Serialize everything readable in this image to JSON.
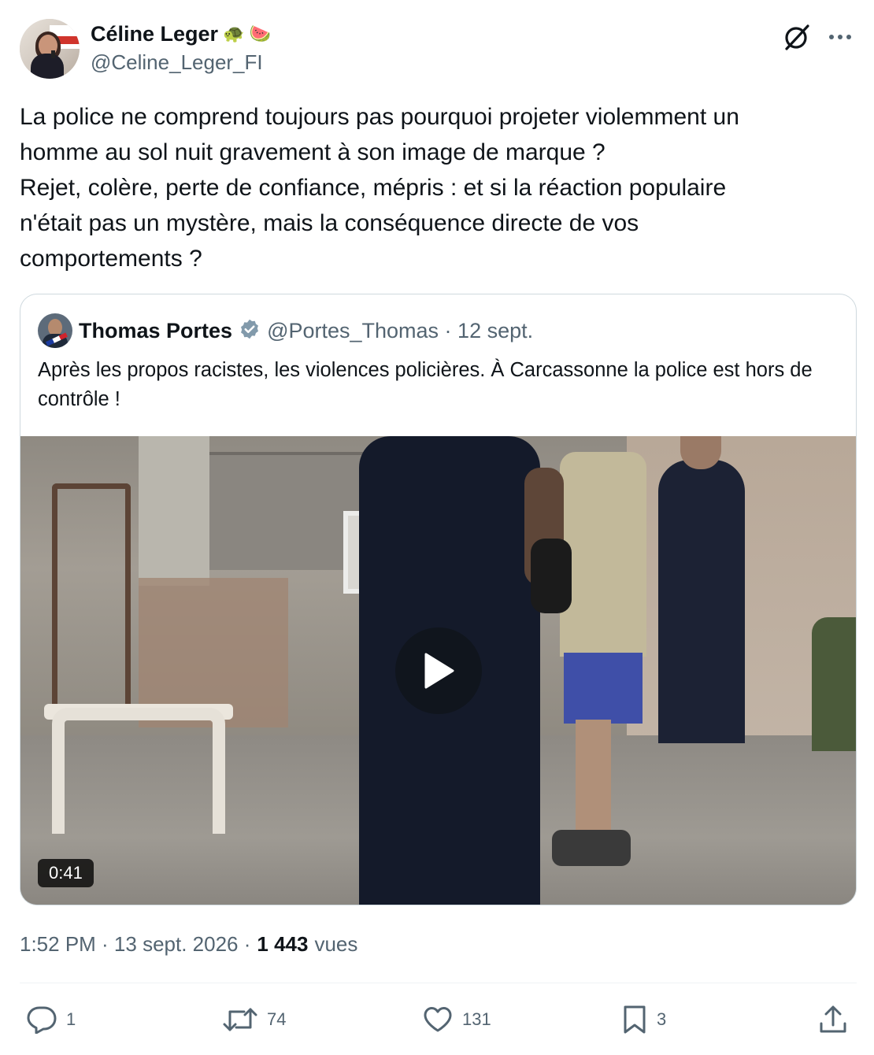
{
  "author": {
    "display_name": "Céline Leger",
    "emoji_1": "🐢",
    "emoji_2": "🍉",
    "handle": "@Celine_Leger_FI"
  },
  "tweet": {
    "text": "La police ne comprend toujours pas pourquoi projeter violemment un\nhomme au sol nuit gravement à son image de marque ?\nRejet, colère, perte de confiance,  mépris : et si la réaction populaire\nn'était pas un mystère, mais la conséquence directe de vos\ncomportements ?"
  },
  "quoted_tweet": {
    "display_name": "Thomas Portes",
    "handle_date": "@Portes_Thomas · 12 sept.",
    "text": "Après les propos racistes, les violences policières. À Carcassonne la police est hors de contrôle !",
    "video_duration": "0:41",
    "verified_color": "#829aab"
  },
  "meta": {
    "time_date": "1:52 PM · 13 sept. 2026 ·",
    "views_count": "1 443",
    "views_label": "vues"
  },
  "actions": {
    "replies": "1",
    "reposts": "74",
    "likes": "131",
    "bookmarks": "3"
  },
  "icons": [
    "grok-icon",
    "more-icon",
    "verified-badge-icon",
    "play-icon",
    "reply-icon",
    "repost-icon",
    "like-icon",
    "bookmark-icon",
    "share-icon"
  ],
  "colors": {
    "text_primary": "#0f1419",
    "text_secondary": "#536471",
    "border": "#cfd9de"
  }
}
